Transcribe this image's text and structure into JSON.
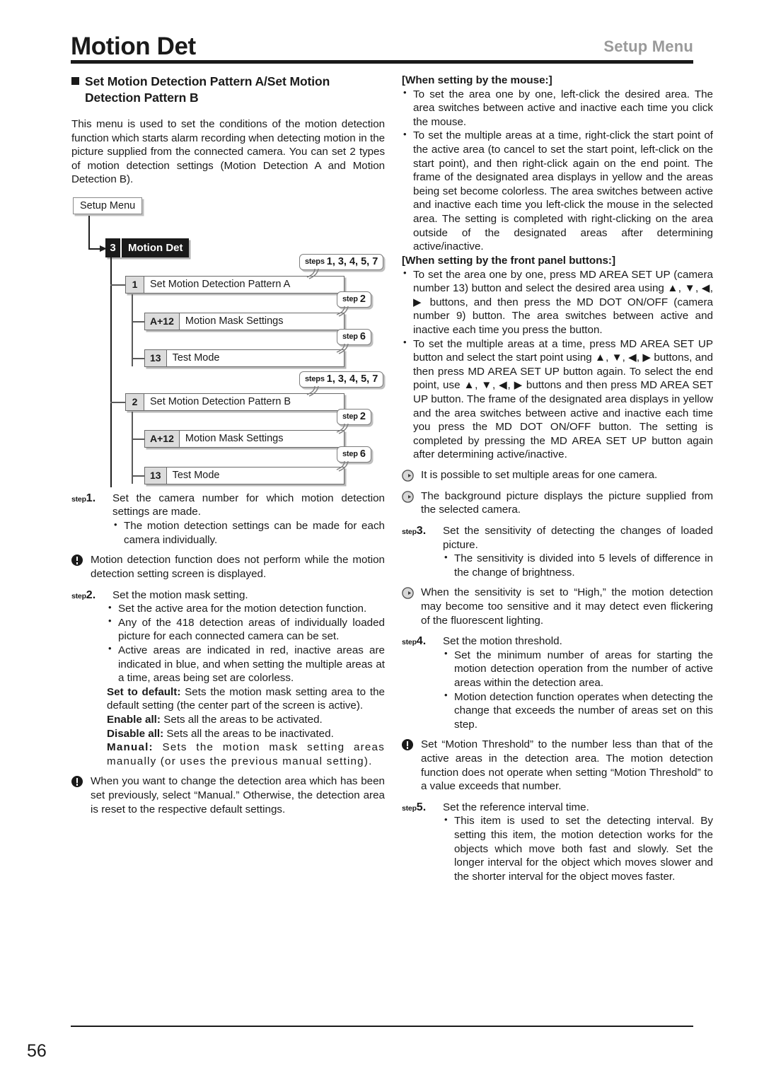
{
  "header": {
    "title": "Motion Det",
    "right_label": "Setup Menu"
  },
  "left_column": {
    "section_heading": "Set Motion Detection Pattern A/Set Motion Detection Pattern B",
    "intro": "This menu is used to set the conditions of the motion detection function which starts alarm recording when detecting motion in the picture supplied from the connected camera. You can set 2 types of motion detection settings (Motion Detection A and Motion Detection B).",
    "diagram": {
      "root": "Setup Menu",
      "menu_number": "3",
      "menu_label": "Motion Det",
      "branches": [
        {
          "num": "1",
          "label": "Set Motion Detection Pattern A",
          "callout_small": "steps",
          "callout_large": "1, 3, 4, 5, 7",
          "children": [
            {
              "num": "A+12",
              "label": "Motion Mask Settings",
              "callout_small": "step",
              "callout_large": "2"
            },
            {
              "num": "13",
              "label": "Test Mode",
              "callout_small": "step",
              "callout_large": "6"
            }
          ]
        },
        {
          "num": "2",
          "label": "Set Motion Detection Pattern B",
          "callout_small": "steps",
          "callout_large": "1, 3, 4, 5, 7",
          "children": [
            {
              "num": "A+12",
              "label": "Motion Mask Settings",
              "callout_small": "step",
              "callout_large": "2"
            },
            {
              "num": "13",
              "label": "Test Mode",
              "callout_small": "step",
              "callout_large": "6"
            }
          ]
        }
      ]
    },
    "step1": {
      "tag_small": "step",
      "tag_number": "1.",
      "text": "Set the camera number for which motion detection settings are made.",
      "bullets": [
        "The motion detection settings can be made for each camera individually."
      ]
    },
    "notice1": "Motion detection function does not perform while the motion detection setting screen is displayed.",
    "step2": {
      "tag_small": "step",
      "tag_number": "2.",
      "text": "Set the motion mask setting.",
      "bullets": [
        "Set the active area for the motion detection function.",
        "Any of the 418 detection areas of individually loaded picture for each connected camera can be set.",
        "Active areas are indicated in red, inactive areas are indicated in blue, and when setting the multiple areas at a time, areas being set are colorless."
      ],
      "definitions": [
        {
          "term": "Set to default:",
          "desc": " Sets the motion mask setting area to the default setting (the center part of the screen is active)."
        },
        {
          "term": "Enable all:",
          "desc": " Sets all the areas to be activated."
        },
        {
          "term": "Disable all:",
          "desc": " Sets all the areas to be inactivated."
        },
        {
          "term": "Manual:",
          "desc": " Sets the motion mask setting areas manually (or uses the previous manual setting)."
        }
      ]
    },
    "notice2": "When you want to change the detection area which has been set previously, select “Manual.” Otherwise, the detection area is reset to the respective default settings."
  },
  "right_column": {
    "mouse_heading": "[When setting by the mouse:]",
    "mouse_bullets": [
      "To set the area one by one, left-click the desired area. The area switches between active and inactive each time you click the mouse.",
      "To set the multiple areas at a time, right-click the start point of the active area (to cancel to set the start point, left-click on the start point), and then right-click again on the end point. The frame of the designated area displays in yellow and the areas being set become colorless. The area switches between active and inactive each time you left-click the mouse in the selected area. The setting is completed with right-clicking on the area outside of the designated areas after determining active/inactive."
    ],
    "panel_heading": "[When setting by the front panel buttons:]",
    "panel_bullets": [
      "To set the area one by one, press MD AREA SET UP (camera number 13) button and select the desired area using ▲, ▼, ◀, ▶ buttons, and then press the MD DOT ON/OFF (camera number 9) button. The area switches between active and inactive each time you press the button.",
      "To set the multiple areas at a time, press MD AREA SET UP button and select the start point using ▲, ▼, ◀, ▶ buttons, and then press MD AREA SET UP button again. To select the end point, use ▲, ▼, ◀, ▶ buttons and then press MD AREA SET UP button. The frame of the designated area displays in yellow and the area switches between active and inactive each time you press the MD DOT ON/OFF button. The setting is completed by pressing the MD AREA SET UP button again after determining active/inactive."
    ],
    "note1": "It is possible to set multiple areas for one camera.",
    "note2": "The background picture displays the picture supplied from the selected camera.",
    "step3": {
      "tag_small": "step",
      "tag_number": "3.",
      "text": "Set the sensitivity of detecting the changes of loaded picture.",
      "bullets": [
        "The sensitivity is divided into 5 levels of difference in the change of brightness."
      ]
    },
    "note3": "When the sensitivity is set to “High,” the motion detection may become too sensitive and it may detect even flickering of the fluorescent lighting.",
    "step4": {
      "tag_small": "step",
      "tag_number": "4.",
      "text": "Set the motion threshold.",
      "bullets": [
        "Set the minimum number of areas for starting the motion detection operation from the number of active areas within the detection area.",
        "Motion detection function operates when detecting the change that exceeds the number of areas set on this step."
      ]
    },
    "notice3": "Set “Motion Threshold” to the number less than that of the active areas in the detection area. The motion detection function does not operate when setting “Motion Threshold” to a value exceeds that number.",
    "step5": {
      "tag_small": "step",
      "tag_number": "5.",
      "text": "Set the reference interval time.",
      "bullets": [
        "This item is used to set the detecting interval. By setting this item, the motion detection works for the objects which move both fast and slowly. Set the longer interval for the object which moves slower and the shorter interval for the object moves faster."
      ]
    }
  },
  "footer": {
    "page_number": "56"
  }
}
